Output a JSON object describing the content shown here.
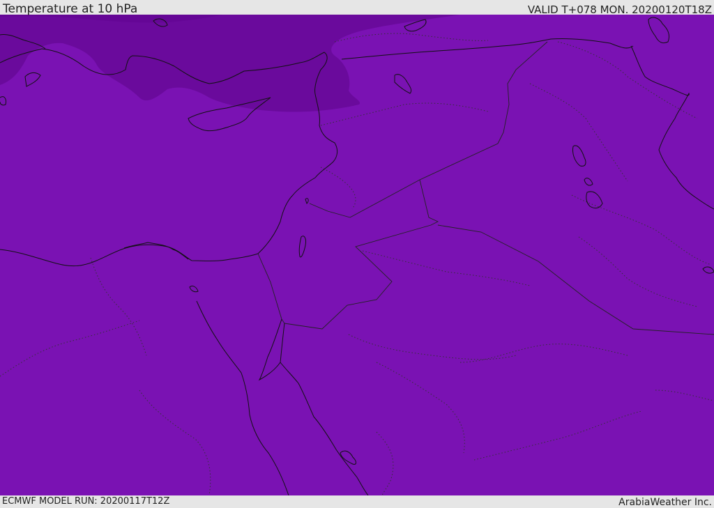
{
  "header": {
    "title": "Temperature at 10 hPa",
    "valid_time": "VALID T+078 MON. 20200120T18Z"
  },
  "footer": {
    "model_run": "ECMWF MODEL RUN: 20200117T12Z",
    "credit": "ArabiaWeather Inc."
  },
  "map": {
    "field_colors": {
      "main": "#7a12b3",
      "cold_band": "#6a0a9c",
      "coldest_band": "#650696"
    },
    "coastline_color": "#111111"
  }
}
